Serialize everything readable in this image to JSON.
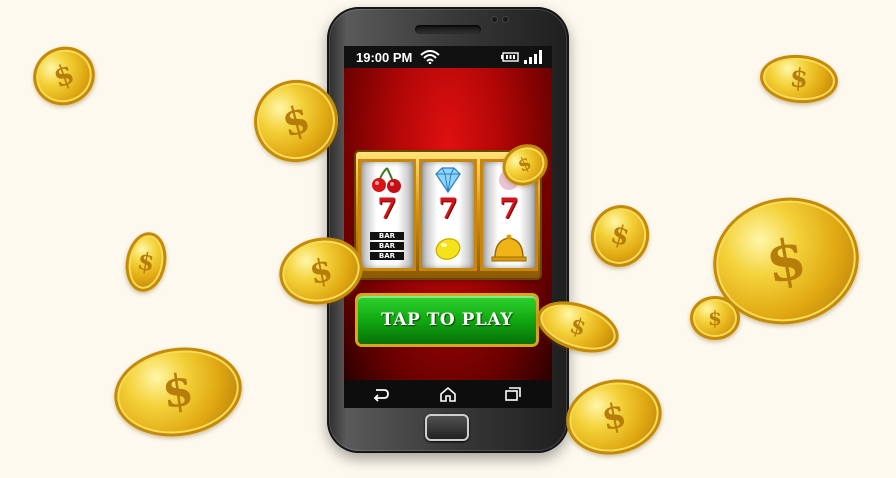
{
  "status_bar": {
    "time": "19:00 PM",
    "icons": [
      "wifi-icon",
      "battery-icon",
      "signal-icon"
    ]
  },
  "slot_machine": {
    "reels": [
      {
        "top": "cherry-icon",
        "middle": "7",
        "bottom": [
          "BAR",
          "BAR",
          "BAR"
        ]
      },
      {
        "top": "diamond-icon",
        "middle": "7",
        "bottom": "lemon-icon"
      },
      {
        "top": "plum-icon",
        "middle": "7",
        "bottom": "bell-icon"
      }
    ]
  },
  "play_button": {
    "label": "TAP TO PLAY"
  },
  "nav_bar": {
    "icons": [
      "back-icon",
      "home-icon",
      "recent-apps-icon"
    ]
  },
  "coin_symbol": "$",
  "colors": {
    "background": "#fdf9ee",
    "screen_red": "#d01010",
    "button_green": "#11a911",
    "gold": "#e0a812",
    "seven_red": "#d6141b"
  }
}
